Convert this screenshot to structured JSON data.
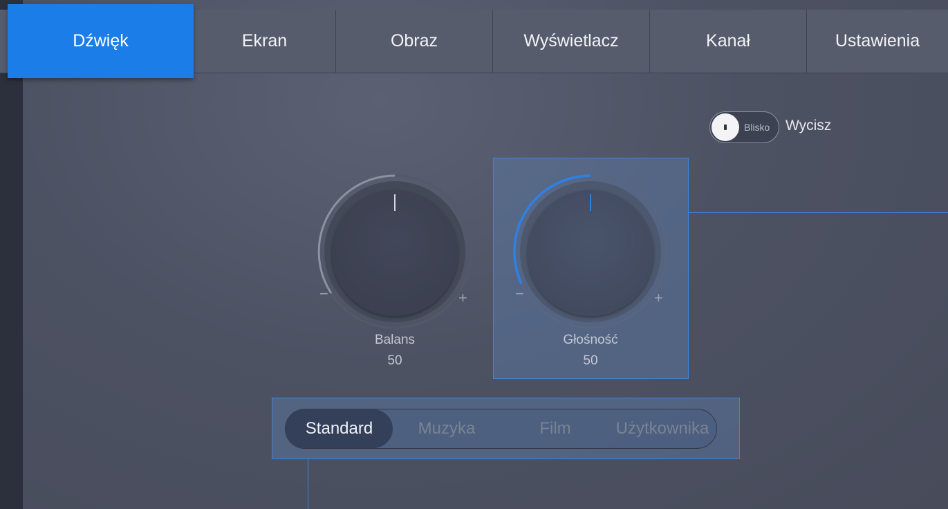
{
  "tabs": [
    {
      "label": "Dźwięk",
      "active": true
    },
    {
      "label": "Ekran",
      "active": false
    },
    {
      "label": "Obraz",
      "active": false
    },
    {
      "label": "Wyświetlacz",
      "active": false
    },
    {
      "label": "Kanał",
      "active": false
    },
    {
      "label": "Ustawienia",
      "active": false
    }
  ],
  "mute": {
    "state_label": "Blisko",
    "label": "Wycisz",
    "on": false
  },
  "knobs": {
    "balance": {
      "label": "Balans",
      "value": "50",
      "minus": "−",
      "plus": "+"
    },
    "volume": {
      "label": "Głośność",
      "value": "50",
      "minus": "−",
      "plus": "+"
    }
  },
  "sound_modes": {
    "options": [
      "Standard",
      "Muzyka",
      "Film",
      "Użytkownika"
    ],
    "selected": "Standard"
  },
  "colors": {
    "accent": "#1b7de8",
    "focus": "#3a86e0"
  }
}
